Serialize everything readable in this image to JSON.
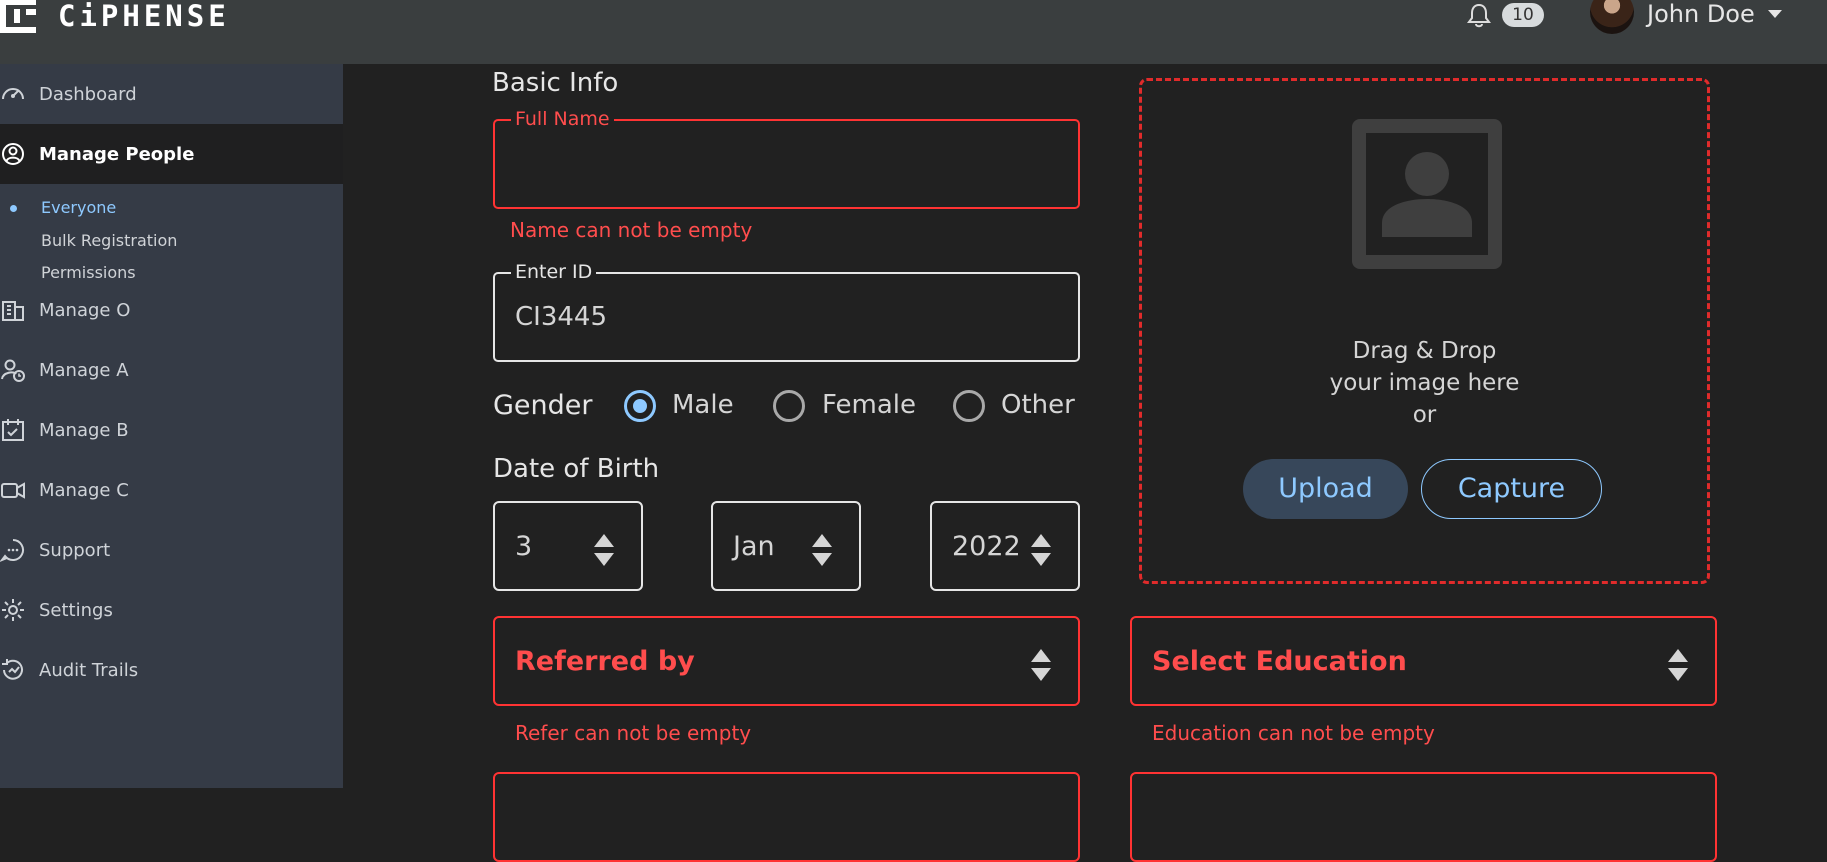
{
  "header": {
    "brand": "CiPHENSE",
    "notification_count": "10",
    "user_name": "John Doe"
  },
  "sidebar": {
    "items": [
      {
        "label": "Dashboard",
        "icon": "dashboard-gauge-icon"
      },
      {
        "label": "Manage People",
        "icon": "user-circle-icon"
      },
      {
        "label": "Manage O",
        "icon": "building-icon"
      },
      {
        "label": "Manage A",
        "icon": "user-clock-icon"
      },
      {
        "label": "Manage B",
        "icon": "calendar-check-icon"
      },
      {
        "label": "Manage C",
        "icon": "video-camera-icon"
      },
      {
        "label": "Support",
        "icon": "chat-bubble-icon"
      },
      {
        "label": "Settings",
        "icon": "gear-icon"
      },
      {
        "label": "Audit Trails",
        "icon": "history-icon"
      }
    ],
    "sub_items": [
      "Everyone",
      "Bulk Registration",
      "Permissions"
    ]
  },
  "form": {
    "section_title": "Basic Info",
    "full_name": {
      "label": "Full Name",
      "value": "",
      "error": "Name can not be empty"
    },
    "enter_id": {
      "label": "Enter ID",
      "value": "CI3445"
    },
    "gender": {
      "label": "Gender",
      "options": [
        "Male",
        "Female",
        "Other"
      ],
      "selected": "Male"
    },
    "dob": {
      "label": "Date of Birth",
      "day": "3",
      "month": "Jan",
      "year": "2022"
    },
    "referred_by": {
      "placeholder": "Referred by",
      "error": "Refer can not be empty"
    },
    "education": {
      "placeholder": "Select Education",
      "error": "Education can not be empty"
    }
  },
  "upload": {
    "line1": "Drag & Drop",
    "line2": "your image here",
    "line3": "or",
    "upload_label": "Upload",
    "capture_label": "Capture"
  },
  "colors": {
    "accent": "#8ec9ff",
    "error": "#ff4d4d",
    "sidebar_bg": "#353b46",
    "header_bg": "#3a3e3f"
  }
}
